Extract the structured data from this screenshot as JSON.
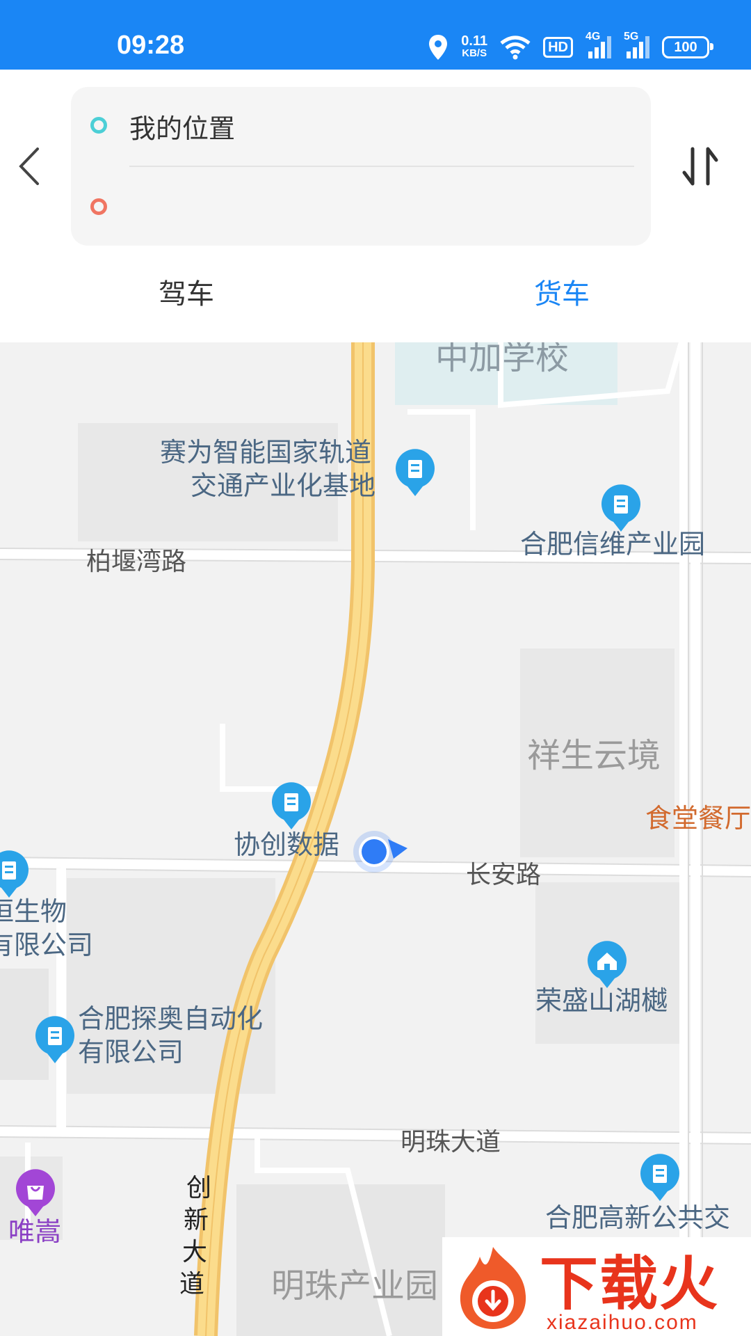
{
  "status_bar": {
    "time": "09:28",
    "net_speed_value": "0.11",
    "net_speed_unit": "KB/S",
    "hd_badge": "HD",
    "signal1_label": "4G",
    "signal2_label": "5G",
    "battery": "100",
    "color": "#1a86f5"
  },
  "route": {
    "start_value": "我的位置",
    "end_placeholder": ""
  },
  "tabs": [
    {
      "label": "驾车",
      "active": false
    },
    {
      "label": "货车",
      "active": true
    }
  ],
  "map": {
    "pois": [
      {
        "name": "中加学校"
      },
      {
        "name": "赛为智能国家轨道交通产业化基地",
        "line1": "赛为智能国家轨道",
        "line2": "交通产业化基地"
      },
      {
        "name": "合肥信维产业园"
      },
      {
        "name": "协创数据"
      },
      {
        "name": "食堂餐厅"
      },
      {
        "name": "恒生物有限公司",
        "line1": "恒生物",
        "line2": "有限公司"
      },
      {
        "name": "荣盛山湖樾"
      },
      {
        "name": "合肥探奥自动化有限公司",
        "line1": "合肥探奥自动化",
        "line2": "有限公司"
      },
      {
        "name": "唯嵩"
      },
      {
        "name": "合肥高新公共交"
      }
    ],
    "roads": [
      "柏堰湾路",
      "长安路",
      "明珠大道",
      "创",
      "新",
      "大",
      "道"
    ],
    "areas": [
      "祥生云境",
      "明珠产业园"
    ]
  },
  "watermark": {
    "title": "下载火",
    "url": "xiazaihuo.com"
  }
}
